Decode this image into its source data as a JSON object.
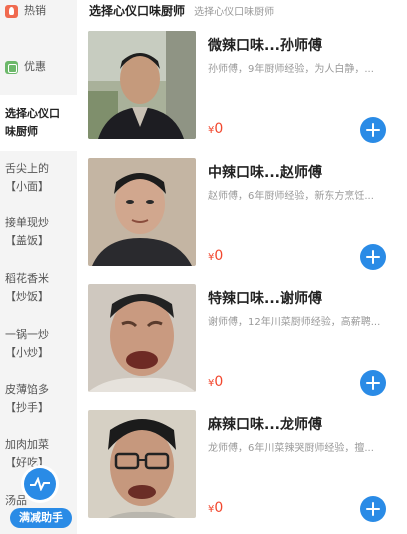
{
  "sidebar": {
    "items": [
      {
        "label": "热销",
        "icon": "hot-icon"
      },
      {
        "label": "优惠",
        "icon": "promo-icon"
      },
      {
        "label": "选择心仪口味厨师"
      },
      {
        "label": "舌尖上的【小面】"
      },
      {
        "label": "接单现炒【盖饭】"
      },
      {
        "label": "稻花香米【炒饭】"
      },
      {
        "label": "一锅一炒【小炒】"
      },
      {
        "label": "皮薄馅多【抄手】"
      },
      {
        "label": "加肉加菜【好吃】"
      },
      {
        "label": "汤品"
      }
    ],
    "active_index": 2
  },
  "assistant": {
    "label": "满减助手",
    "icon": "pulse-icon"
  },
  "header": {
    "title": "选择心仪口味厨师",
    "subtitle": "选择心仪口味厨师"
  },
  "items": [
    {
      "name": "微辣口味...孙师傅",
      "desc": "孙师傅，9年厨师经验，为人白静，...",
      "price": "0",
      "currency": "¥"
    },
    {
      "name": "中辣口味...赵师傅",
      "desc": "赵师傅，6年厨师经验，新东方烹饪...",
      "price": "0",
      "currency": "¥"
    },
    {
      "name": "特辣口味...谢师傅",
      "desc": "谢师傅，12年川菜厨师经验，高薪聘...",
      "price": "0",
      "currency": "¥"
    },
    {
      "name": "麻辣口味...龙师傅",
      "desc": "龙师傅，6年川菜辣哭厨师经验，擅...",
      "price": "0",
      "currency": "¥"
    }
  ],
  "colors": {
    "accent": "#2a8be6",
    "price": "#f2472e",
    "sidebar_bg": "#f4f4f4"
  }
}
